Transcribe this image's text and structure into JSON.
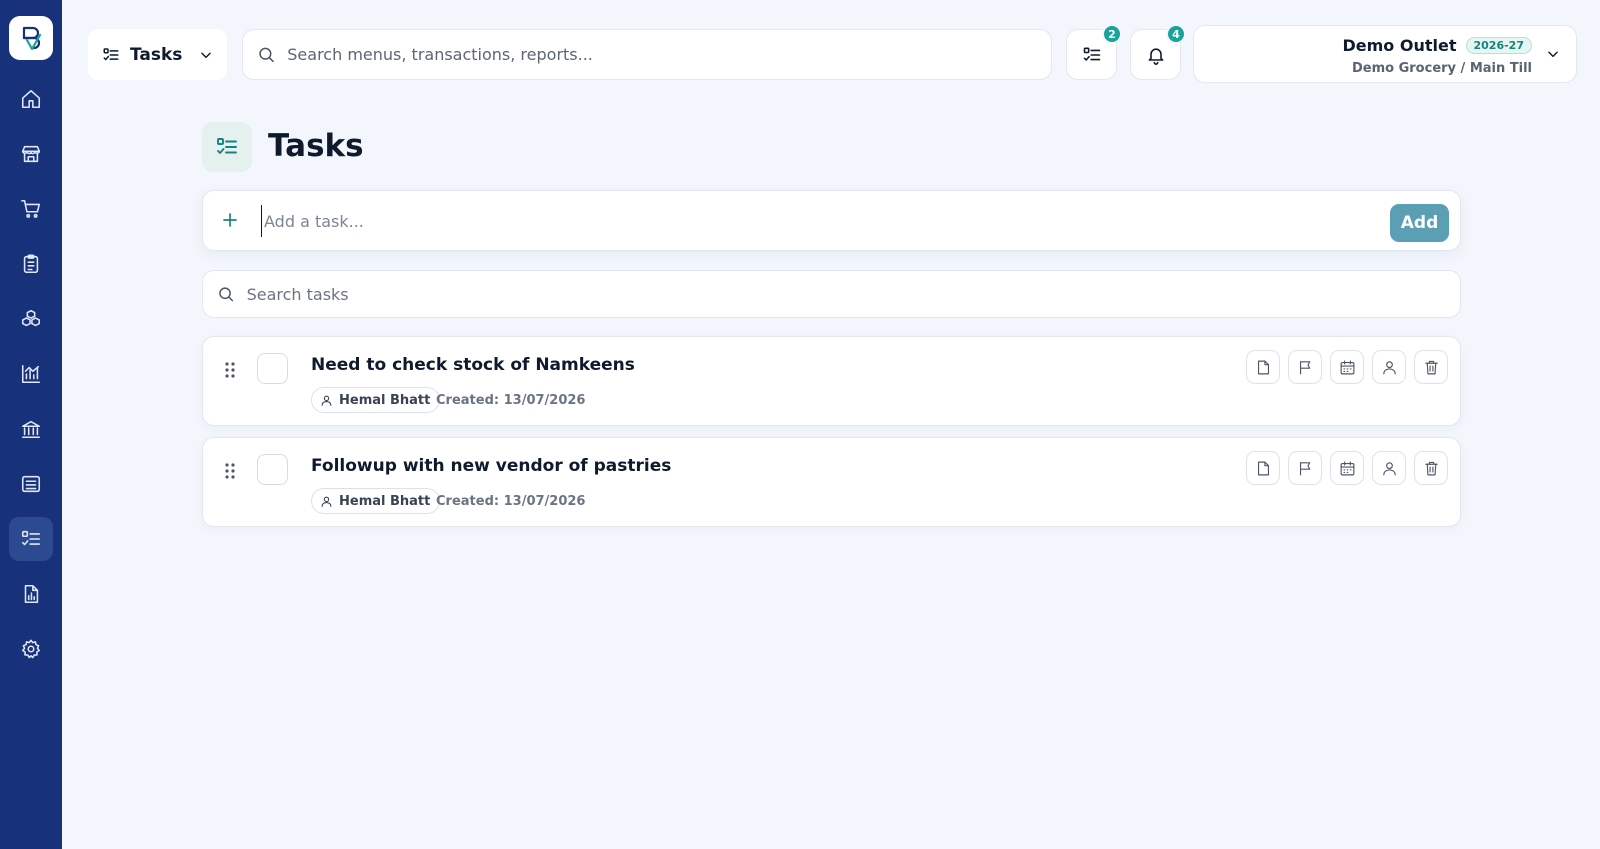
{
  "sidebar": {
    "logo_icon": "app-logo",
    "items": [
      {
        "name": "home",
        "icon": "home-icon",
        "active": false
      },
      {
        "name": "store",
        "icon": "store-icon",
        "active": false
      },
      {
        "name": "cart",
        "icon": "cart-icon",
        "active": false
      },
      {
        "name": "clipboard",
        "icon": "clipboard-icon",
        "active": false
      },
      {
        "name": "products",
        "icon": "cubes-icon",
        "active": false
      },
      {
        "name": "analytics",
        "icon": "chart-icon",
        "active": false
      },
      {
        "name": "bank",
        "icon": "bank-icon",
        "active": false
      },
      {
        "name": "register",
        "icon": "register-icon",
        "active": false
      },
      {
        "name": "tasks",
        "icon": "tasks-icon",
        "active": true
      },
      {
        "name": "reports",
        "icon": "report-icon",
        "active": false
      },
      {
        "name": "settings",
        "icon": "gear-icon",
        "active": false
      }
    ]
  },
  "header": {
    "menu_label": "Tasks",
    "search_placeholder": "Search menus, transactions, reports...",
    "tasks_badge": "2",
    "notifications_badge": "4",
    "outlet_name": "Demo Outlet",
    "fiscal_year": "2026-27",
    "outlet_sub": "Demo Grocery / Main Till"
  },
  "page": {
    "title": "Tasks",
    "add_placeholder": "Add a task...",
    "add_button": "Add",
    "search_placeholder": "Search tasks"
  },
  "tasks": [
    {
      "title": "Need to check stock of Namkeens",
      "assignee": "Hemal Bhatt",
      "created": "Created: 13/07/2026"
    },
    {
      "title": "Followup with new vendor of pastries",
      "assignee": "Hemal Bhatt",
      "created": "Created: 13/07/2026"
    }
  ],
  "colors": {
    "sidebar_bg": "#17327a",
    "accent_teal": "#1aa39a",
    "add_button": "#5a9fb4",
    "page_bg": "#f3f6fc"
  }
}
